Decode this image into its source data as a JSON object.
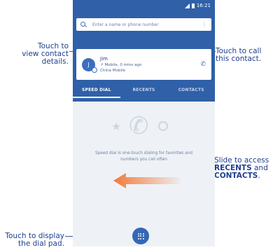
{
  "status": {
    "time": "16:21"
  },
  "search": {
    "placeholder": "Enter a name or phone number",
    "menu_icon": "more-vert-icon"
  },
  "recent_contact": {
    "initial": "J",
    "name": "Jim",
    "detail": "Mobile, 0 mins ago",
    "carrier": "China Mobile"
  },
  "tabs": [
    {
      "label": "SPEED DIAL",
      "active": true
    },
    {
      "label": "RECENTS",
      "active": false
    },
    {
      "label": "CONTACTS",
      "active": false
    }
  ],
  "speed_dial": {
    "message_line1": "Speed dial is one-touch dialing for favorites and",
    "message_line2": "numbers you call often"
  },
  "callouts": {
    "view_contact": [
      "Touch to",
      "view contact",
      "details."
    ],
    "call_contact": [
      "Touch to call",
      "this contact."
    ],
    "slide_line1": "Slide to access",
    "slide_recents": "RECENTS",
    "slide_and": " and",
    "slide_contacts": "CONTACTS",
    "slide_period": ".",
    "dial_pad": [
      "Touch to display",
      "the dial pad."
    ]
  },
  "colors": {
    "primary": "#2f60a8",
    "accent_arrow": "#f08a4b",
    "callout_text": "#1f3f8f"
  }
}
